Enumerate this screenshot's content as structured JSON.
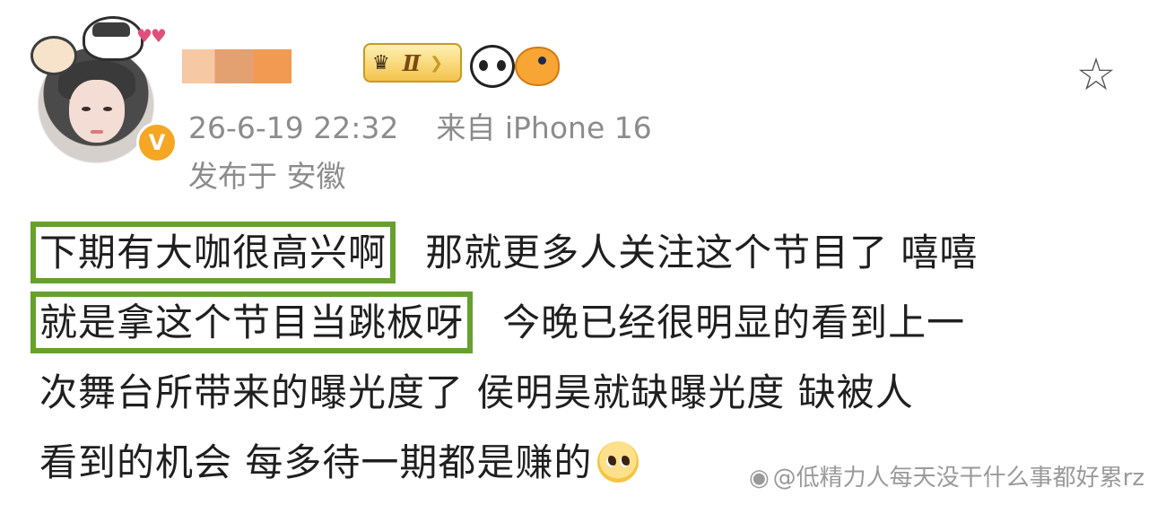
{
  "post": {
    "author_name_obscured": true,
    "level_badge": "Ⅱ",
    "timestamp": "26-6-19 22:32",
    "source": "来自 iPhone 16",
    "location": "发布于 安徽",
    "body_lines": [
      [
        "下期有大咖很高兴啊",
        "那就更多人关注这个节目了 嘻嘻"
      ],
      [
        "就是拿这个节目当跳板呀",
        "今晚已经很明显的看到上一"
      ],
      [
        "次舞台所带来的曝光度了  侯明昊就缺曝光度  缺被人"
      ],
      [
        "看到的机会  每多待一期都是赚的"
      ]
    ],
    "highlighted_phrases": [
      "下期有大咖很高兴啊",
      "就是拿这个节目当跳板呀"
    ],
    "highlight_color": "#66a12d"
  },
  "icons": {
    "favorite": "star-outline-icon",
    "verified": "verified-v-icon",
    "emoji": "pleading-face-emoji"
  },
  "watermark": {
    "text": "@低精力人每天没干什么事都好累rz"
  },
  "colors": {
    "meta_text": "#8c8c8c",
    "body_text": "#1f1f1f",
    "verified_badge": "#f5a623"
  }
}
